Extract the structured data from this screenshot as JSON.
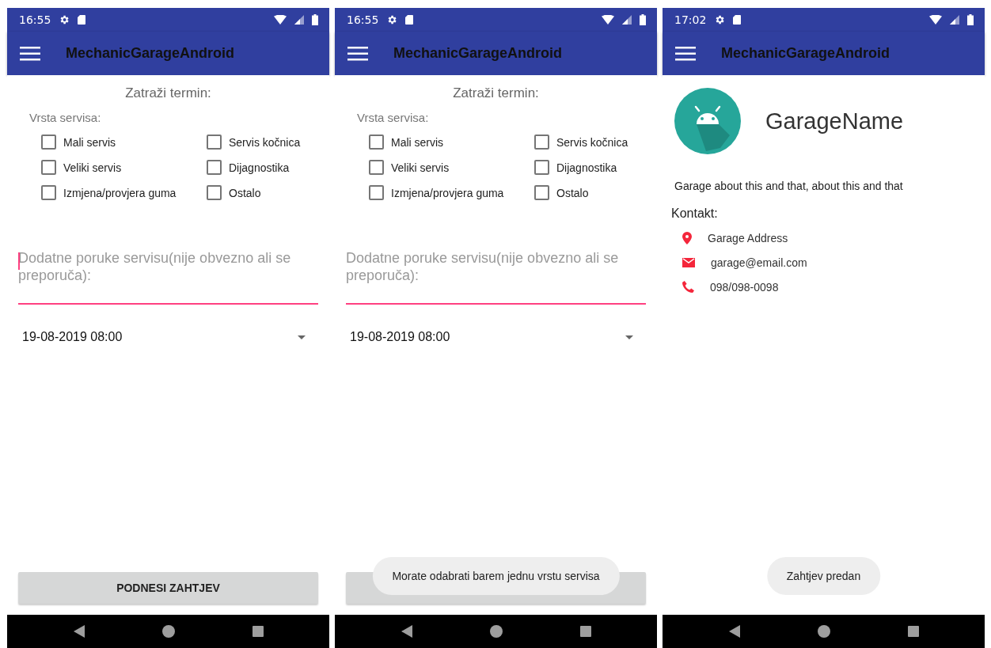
{
  "phones": [
    {
      "status_bar": {
        "time": "16:55"
      },
      "app_bar": {
        "title": "MechanicGarageAndroid"
      },
      "screen": {
        "kind": "request",
        "heading": "Zatraži termin:",
        "service_type_label": "Vrsta servisa:",
        "options": [
          {
            "label": "Mali servis",
            "checked": false
          },
          {
            "label": "Servis kočnica",
            "checked": false
          },
          {
            "label": "Veliki servis",
            "checked": false
          },
          {
            "label": "Dijagnostika",
            "checked": false
          },
          {
            "label": "Izmjena/provjera guma",
            "checked": false
          },
          {
            "label": "Ostalo",
            "checked": false
          }
        ],
        "message_field": {
          "placeholder": "Dodatne poruke servisu(nije obvezno ali se preporuča):",
          "cursor": true
        },
        "date_dropdown": {
          "value": "19-08-2019 08:00"
        },
        "submit_button": {
          "label": "PODNESI ZAHTJEV"
        }
      }
    },
    {
      "status_bar": {
        "time": "16:55"
      },
      "app_bar": {
        "title": "MechanicGarageAndroid"
      },
      "screen": {
        "kind": "request",
        "heading": "Zatraži termin:",
        "service_type_label": "Vrsta servisa:",
        "options": [
          {
            "label": "Mali servis",
            "checked": false
          },
          {
            "label": "Servis kočnica",
            "checked": false
          },
          {
            "label": "Veliki servis",
            "checked": false
          },
          {
            "label": "Dijagnostika",
            "checked": false
          },
          {
            "label": "Izmjena/provjera guma",
            "checked": false
          },
          {
            "label": "Ostalo",
            "checked": false
          }
        ],
        "message_field": {
          "placeholder": "Dodatne poruke servisu(nije obvezno ali se preporuča):",
          "cursor": false
        },
        "date_dropdown": {
          "value": "19-08-2019 08:00"
        },
        "toast": "Morate odabrati barem jednu vrstu servisa"
      }
    },
    {
      "status_bar": {
        "time": "17:02"
      },
      "app_bar": {
        "title": "MechanicGarageAndroid"
      },
      "screen": {
        "kind": "garage",
        "name": "GarageName",
        "description": "Garage about this and that, about this and that",
        "contact_label": "Kontakt:",
        "contacts": [
          {
            "kind": "address",
            "text": "Garage Address"
          },
          {
            "kind": "email",
            "text": "garage@email.com"
          },
          {
            "kind": "phone",
            "text": "098/098-0098"
          }
        ],
        "toast": "Zahtjev predan"
      }
    }
  ]
}
